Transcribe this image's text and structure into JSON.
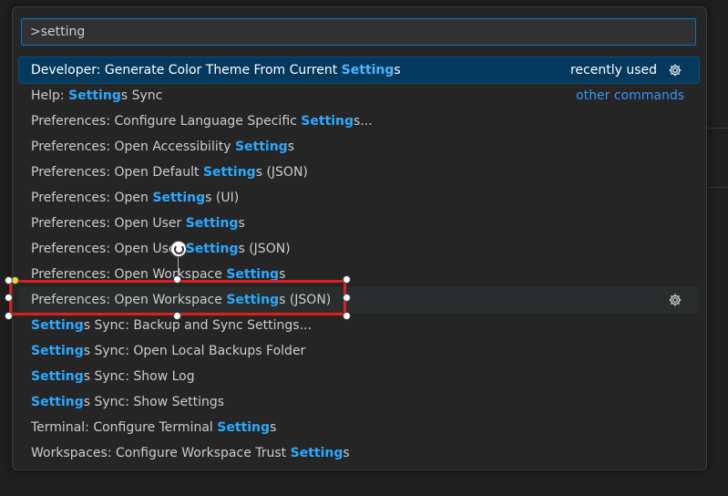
{
  "search": {
    "value": ">setting"
  },
  "items": [
    {
      "pre": "Developer: Generate Color Theme From Current ",
      "hl": "Setting",
      "post": "s",
      "right": "recently used"
    },
    {
      "pre": "Help: ",
      "hl": "Setting",
      "post": "s Sync",
      "right": "other commands"
    },
    {
      "pre": "Preferences: Configure Language Specific ",
      "hl": "Setting",
      "post": "s..."
    },
    {
      "pre": "Preferences: Open Accessibility ",
      "hl": "Setting",
      "post": "s"
    },
    {
      "pre": "Preferences: Open Default ",
      "hl": "Setting",
      "post": "s (JSON)"
    },
    {
      "pre": "Preferences: Open ",
      "hl": "Setting",
      "post": "s (UI)"
    },
    {
      "pre": "Preferences: Open User ",
      "hl": "Setting",
      "post": "s"
    },
    {
      "pre": "Preferences: Open User ",
      "hl": "Setting",
      "post": "s (JSON)"
    },
    {
      "pre": "Preferences: Open Workspace ",
      "hl": "Setting",
      "post": "s"
    },
    {
      "pre": "Preferences: Open Workspace ",
      "hl": "Setting",
      "post": "s (JSON)"
    },
    {
      "pre": "",
      "hl": "Setting",
      "post": "s Sync: Backup and Sync Settings..."
    },
    {
      "pre": "",
      "hl": "Setting",
      "post": "s Sync: Open Local Backups Folder"
    },
    {
      "pre": "",
      "hl": "Setting",
      "post": "s Sync: Show Log"
    },
    {
      "pre": "",
      "hl": "Setting",
      "post": "s Sync: Show Settings"
    },
    {
      "pre": "Terminal: Configure Terminal ",
      "hl": "Setting",
      "post": "s"
    },
    {
      "pre": "Workspaces: Configure Workspace Trust ",
      "hl": "Setting",
      "post": "s"
    }
  ],
  "icons": {
    "gear": "gear-icon",
    "rotate": "rotate-handle-icon"
  },
  "colors": {
    "accent": "#0078d4",
    "highlight": "#2aaaff",
    "selection": "#04395e",
    "annotation": "#e01e1e"
  }
}
